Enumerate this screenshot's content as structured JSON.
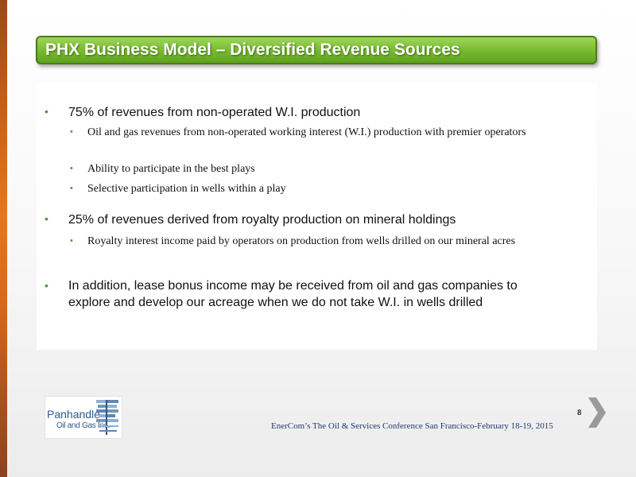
{
  "slide": {
    "title": "PHX Business Model – Diversified Revenue Sources",
    "page_number": "8",
    "footer": "EnerCom’s The Oil & Services Conference San Francisco-February 18-19, 2015"
  },
  "bullets": [
    {
      "text": "75% of revenues from non-operated W.I. production",
      "sub": [
        "Oil and gas revenues from non-operated working interest (W.I.) production with premier operators",
        "Ability to participate in the best plays",
        "Selective participation in wells within a play"
      ]
    },
    {
      "text": "25% of revenues derived from royalty production on mineral holdings",
      "sub": [
        "Royalty interest income paid by operators on production from wells drilled on our mineral acres"
      ]
    },
    {
      "text": "In addition, lease bonus income may be received from oil and gas companies to explore and develop our acreage when we do not take W.I. in wells drilled",
      "sub": []
    }
  ],
  "logo": {
    "name": "Panhandle",
    "subtitle": "Oil and Gas Inc."
  },
  "colors": {
    "accent_green": "#7cbf34",
    "accent_orange": "#e8761a",
    "footer_blue": "#1f3a6e"
  }
}
